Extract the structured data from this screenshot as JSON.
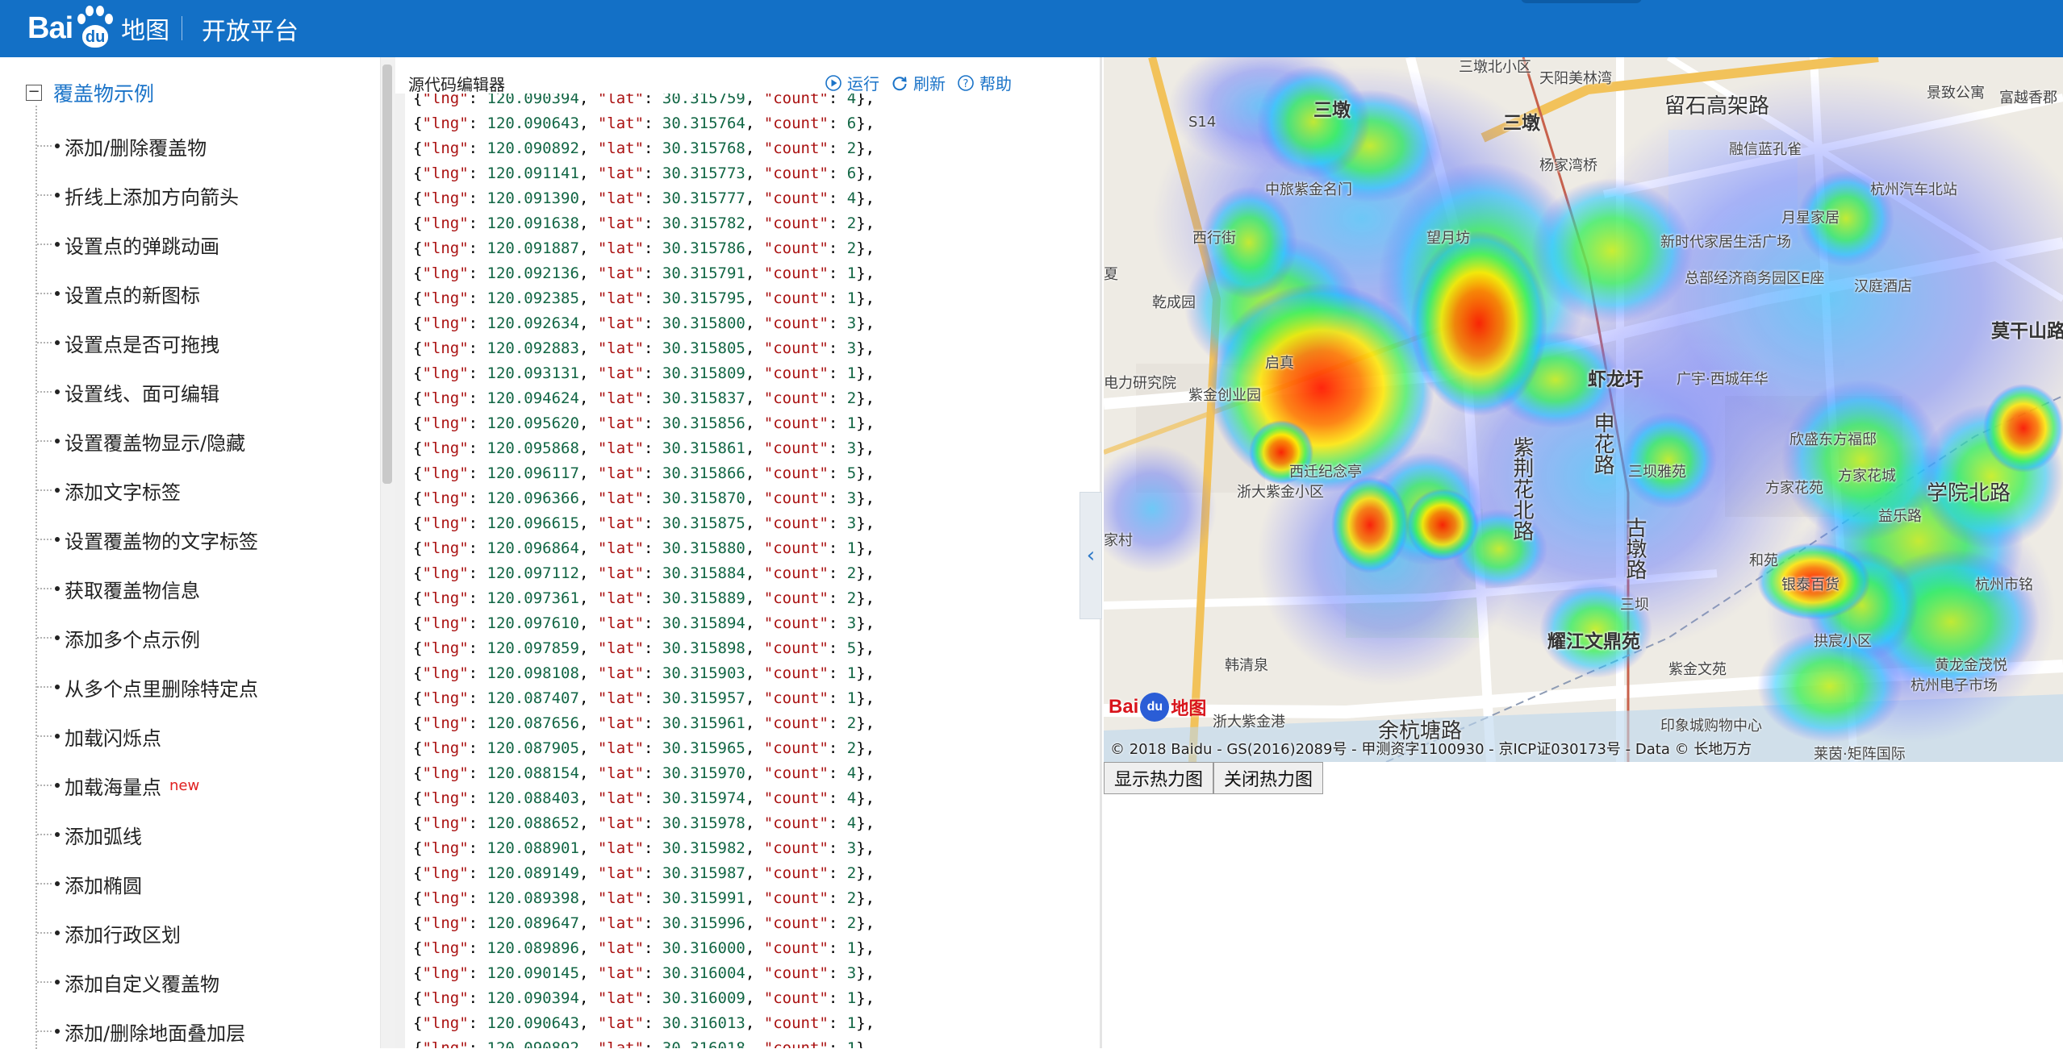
{
  "header": {
    "logo_bai": "Bai",
    "logo_du": "du",
    "logo_map": "地图",
    "platform": "开放平台"
  },
  "sidebar": {
    "category": "覆盖物示例",
    "toggle": "−",
    "items": [
      {
        "label": "添加/删除覆盖物"
      },
      {
        "label": "折线上添加方向箭头"
      },
      {
        "label": "设置点的弹跳动画"
      },
      {
        "label": "设置点的新图标"
      },
      {
        "label": "设置点是否可拖拽"
      },
      {
        "label": "设置线、面可编辑"
      },
      {
        "label": "设置覆盖物显示/隐藏"
      },
      {
        "label": "添加文字标签"
      },
      {
        "label": "设置覆盖物的文字标签"
      },
      {
        "label": "获取覆盖物信息"
      },
      {
        "label": "添加多个点示例"
      },
      {
        "label": "从多个点里删除特定点"
      },
      {
        "label": "加载闪烁点"
      },
      {
        "label": "加载海量点",
        "badge": "new"
      },
      {
        "label": "添加弧线"
      },
      {
        "label": "添加椭圆"
      },
      {
        "label": "添加行政区划"
      },
      {
        "label": "添加自定义覆盖物"
      },
      {
        "label": "添加/删除地面叠加层"
      }
    ]
  },
  "editor": {
    "title": "源代码编辑器",
    "run_label": "运行",
    "refresh_label": "刷新",
    "help_label": "帮助",
    "lines": [
      [
        "120.090394",
        "30.315759",
        "4"
      ],
      [
        "120.090643",
        "30.315764",
        "6"
      ],
      [
        "120.090892",
        "30.315768",
        "2"
      ],
      [
        "120.091141",
        "30.315773",
        "6"
      ],
      [
        "120.091390",
        "30.315777",
        "4"
      ],
      [
        "120.091638",
        "30.315782",
        "2"
      ],
      [
        "120.091887",
        "30.315786",
        "2"
      ],
      [
        "120.092136",
        "30.315791",
        "1"
      ],
      [
        "120.092385",
        "30.315795",
        "1"
      ],
      [
        "120.092634",
        "30.315800",
        "3"
      ],
      [
        "120.092883",
        "30.315805",
        "3"
      ],
      [
        "120.093131",
        "30.315809",
        "1"
      ],
      [
        "120.094624",
        "30.315837",
        "2"
      ],
      [
        "120.095620",
        "30.315856",
        "1"
      ],
      [
        "120.095868",
        "30.315861",
        "3"
      ],
      [
        "120.096117",
        "30.315866",
        "5"
      ],
      [
        "120.096366",
        "30.315870",
        "3"
      ],
      [
        "120.096615",
        "30.315875",
        "3"
      ],
      [
        "120.096864",
        "30.315880",
        "1"
      ],
      [
        "120.097112",
        "30.315884",
        "2"
      ],
      [
        "120.097361",
        "30.315889",
        "2"
      ],
      [
        "120.097610",
        "30.315894",
        "3"
      ],
      [
        "120.097859",
        "30.315898",
        "5"
      ],
      [
        "120.098108",
        "30.315903",
        "1"
      ],
      [
        "120.087407",
        "30.315957",
        "1"
      ],
      [
        "120.087656",
        "30.315961",
        "2"
      ],
      [
        "120.087905",
        "30.315965",
        "2"
      ],
      [
        "120.088154",
        "30.315970",
        "4"
      ],
      [
        "120.088403",
        "30.315974",
        "4"
      ],
      [
        "120.088652",
        "30.315978",
        "4"
      ],
      [
        "120.088901",
        "30.315982",
        "3"
      ],
      [
        "120.089149",
        "30.315987",
        "2"
      ],
      [
        "120.089398",
        "30.315991",
        "2"
      ],
      [
        "120.089647",
        "30.315996",
        "2"
      ],
      [
        "120.089896",
        "30.316000",
        "1"
      ],
      [
        "120.090145",
        "30.316004",
        "3"
      ],
      [
        "120.090394",
        "30.316009",
        "1"
      ],
      [
        "120.090643",
        "30.316013",
        "1"
      ],
      [
        "120.090892",
        "30.316018",
        "1"
      ]
    ]
  },
  "map": {
    "labels": [
      "三墩北小区",
      "天阳美林湾",
      "留石高架路",
      "景致公寓",
      "富越香郡",
      "S14",
      "三墩",
      "三墩",
      "杨家湾桥",
      "融信蓝孔雀",
      "杭州汽车北站",
      "中旅紫金名门",
      "月星家居",
      "西行街",
      "望月坊",
      "新时代家居生活广场",
      "总部经济商务园区E座",
      "汉庭酒店",
      "乾成园",
      "莫干山路",
      "启真",
      "虾龙圩",
      "广宇·西城年华",
      "电力研究院",
      "紫金创业园",
      "申花路",
      "欣盛东方福邸",
      "学院北路",
      "西迁纪念亭",
      "紫荆花北路",
      "三坝雅苑",
      "方家花城",
      "方家花苑",
      "浙大紫金小区",
      "古墩路",
      "益乐路",
      "家村",
      "和苑",
      "银泰百货",
      "杭州市铭",
      "三坝",
      "耀江文鼎苑",
      "韩清泉",
      "紫金文苑",
      "拱宸小区",
      "黄龙金茂悦",
      "杭州电子市场",
      "浙大紫金港",
      "余杭塘路",
      "印象城购物中心",
      "莱茵·矩阵国际",
      "夏"
    ],
    "logo_text": "Bai",
    "logo_du": "du",
    "logo_map": "地图",
    "copyright": "© 2018 Baidu - GS(2016)2089号 - 甲测资字1100930 - 京ICP证030173号 - Data © 长地万方"
  },
  "buttons": {
    "show": "显示热力图",
    "hide": "关闭热力图"
  },
  "colors": {
    "header": "#1370c6",
    "link": "#1a73c8",
    "badge": "#e02020"
  }
}
